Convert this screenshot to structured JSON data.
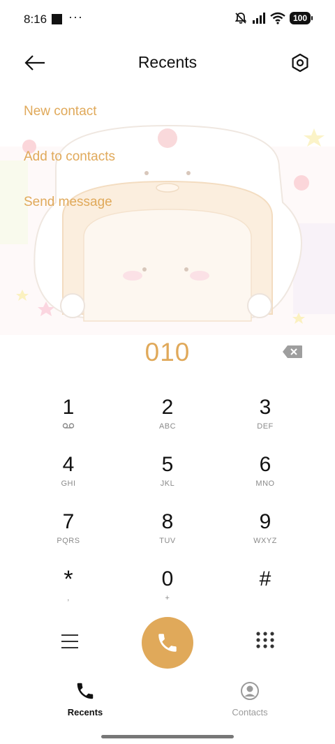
{
  "status_bar": {
    "time": "8:16",
    "dots": "···",
    "battery": "100"
  },
  "header": {
    "title": "Recents"
  },
  "actions": {
    "new_contact": "New contact",
    "add_to_contacts": "Add to contacts",
    "send_message": "Send message"
  },
  "dialer": {
    "number": "010"
  },
  "keypad": {
    "keys": [
      {
        "digit": "1",
        "letters": ""
      },
      {
        "digit": "2",
        "letters": "ABC"
      },
      {
        "digit": "3",
        "letters": "DEF"
      },
      {
        "digit": "4",
        "letters": "GHI"
      },
      {
        "digit": "5",
        "letters": "JKL"
      },
      {
        "digit": "6",
        "letters": "MNO"
      },
      {
        "digit": "7",
        "letters": "PQRS"
      },
      {
        "digit": "8",
        "letters": "TUV"
      },
      {
        "digit": "9",
        "letters": "WXYZ"
      },
      {
        "digit": "*",
        "letters": ","
      },
      {
        "digit": "0",
        "letters": "+"
      },
      {
        "digit": "#",
        "letters": ""
      }
    ]
  },
  "bottom_nav": {
    "recents": "Recents",
    "contacts": "Contacts"
  },
  "colors": {
    "accent": "#e0a95a"
  },
  "icons": {
    "back": "arrow-left-icon",
    "settings": "hexagon-gear-icon",
    "backspace": "backspace-icon",
    "voicemail": "voicemail-icon",
    "menu": "hamburger-menu-icon",
    "call": "phone-icon",
    "dialpad": "dialpad-icon",
    "recents_tab": "phone-icon",
    "contacts_tab": "person-circle-icon"
  }
}
